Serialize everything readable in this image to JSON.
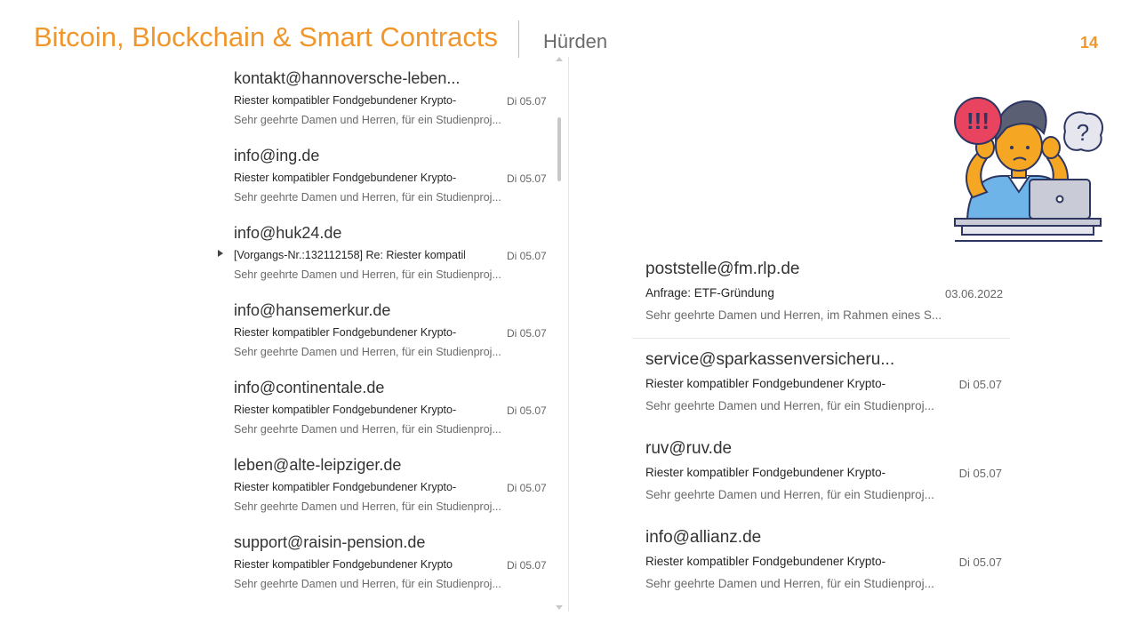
{
  "slide": {
    "title": "Bitcoin, Blockchain & Smart Contracts",
    "subtitle": "Hürden",
    "page_number": "14"
  },
  "mail_list": [
    {
      "sender": "kontakt@hannoversche-leben...",
      "subject": "Riester kompatibler Fondgebundener Krypto-",
      "date": "Di 05.07",
      "preview": "Sehr geehrte Damen und Herren, für ein Studienproj...",
      "has_thread": false
    },
    {
      "sender": "info@ing.de",
      "subject": "Riester kompatibler Fondgebundener Krypto-",
      "date": "Di 05.07",
      "preview": "Sehr geehrte Damen und Herren, für ein Studienproj...",
      "has_thread": false
    },
    {
      "sender": "info@huk24.de",
      "subject": "[Vorgangs-Nr.:132112158] Re: Riester kompatib",
      "date": "Di 05.07",
      "preview": "Sehr geehrte Damen und Herren, für ein Studienproj...",
      "has_thread": true
    },
    {
      "sender": "info@hansemerkur.de",
      "subject": "Riester kompatibler Fondgebundener Krypto-",
      "date": "Di 05.07",
      "preview": "Sehr geehrte Damen und Herren, für ein Studienproj...",
      "has_thread": false
    },
    {
      "sender": "info@continentale.de",
      "subject": "Riester kompatibler Fondgebundener Krypto-",
      "date": "Di 05.07",
      "preview": "Sehr geehrte Damen und Herren, für ein Studienproj...",
      "has_thread": false
    },
    {
      "sender": "leben@alte-leipziger.de",
      "subject": "Riester kompatibler Fondgebundener Krypto-",
      "date": "Di 05.07",
      "preview": "Sehr geehrte Damen und Herren, für ein Studienproj...",
      "has_thread": false
    },
    {
      "sender": "support@raisin-pension.de",
      "subject": "Riester kompatibler Fondgebundener Krypto",
      "date": "Di 05.07",
      "preview": "Sehr geehrte Damen und Herren, für ein Studienproj...",
      "has_thread": false
    }
  ],
  "right_list": [
    {
      "sender": "poststelle@fm.rlp.de",
      "subject": "Anfrage: ETF-Gründung",
      "date": "03.06.2022",
      "preview": "Sehr geehrte Damen und Herren, im Rahmen eines S..."
    },
    {
      "sender": "service@sparkassenversicheru...",
      "subject": "Riester kompatibler Fondgebundener Krypto-",
      "date": "Di 05.07",
      "preview": "Sehr geehrte Damen und Herren, für ein Studienproj..."
    },
    {
      "sender": "ruv@ruv.de",
      "subject": "Riester kompatibler Fondgebundener Krypto-",
      "date": "Di 05.07",
      "preview": "Sehr geehrte Damen und Herren, für ein Studienproj..."
    },
    {
      "sender": "info@allianz.de",
      "subject": "Riester kompatibler Fondgebundener Krypto-",
      "date": "Di 05.07",
      "preview": "Sehr geehrte Damen und Herren, für ein Studienproj..."
    }
  ],
  "illustration": {
    "alert_text": "!!!",
    "question_text": "?",
    "icon": "confused-person-laptop-icon"
  },
  "colors": {
    "accent": "#f0962a",
    "text_primary": "#333333",
    "text_muted": "#6b6b6b",
    "alert_bubble": "#e8435f",
    "shirt": "#6fb4e8",
    "skin": "#f5a623"
  }
}
